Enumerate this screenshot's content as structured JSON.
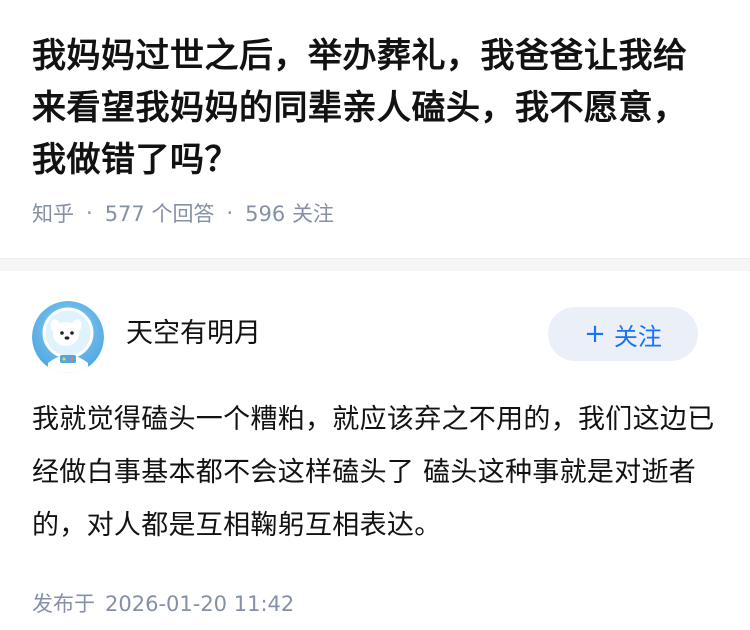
{
  "question": {
    "title": "我妈妈过世之后，举办葬礼，我爸爸让我给来看望我妈妈的同辈亲人磕头，我不愿意，我做错了吗？",
    "platform": "知乎",
    "separator": "·",
    "answers_count": "577",
    "answers_label": "个回答",
    "followers_count": "596",
    "followers_label": "关注"
  },
  "answer": {
    "author_name": "天空有明月",
    "avatar_icon": "astronaut-dog-avatar-icon",
    "follow_button": {
      "icon": "+",
      "label": "关注"
    },
    "content": "我就觉得磕头一个糟粕，就应该弃之不用的，我们这边已经做白事基本都不会这样磕头了 磕头这种事就是对逝者的，对人都是互相鞠躬互相表达。",
    "publish_label": "发布于",
    "publish_time": "2026-01-20 11:42"
  },
  "colors": {
    "accent": "#1772f6",
    "follow_bg": "#ebf0f8",
    "meta": "#8590a6",
    "divider": "#f6f6f6"
  }
}
